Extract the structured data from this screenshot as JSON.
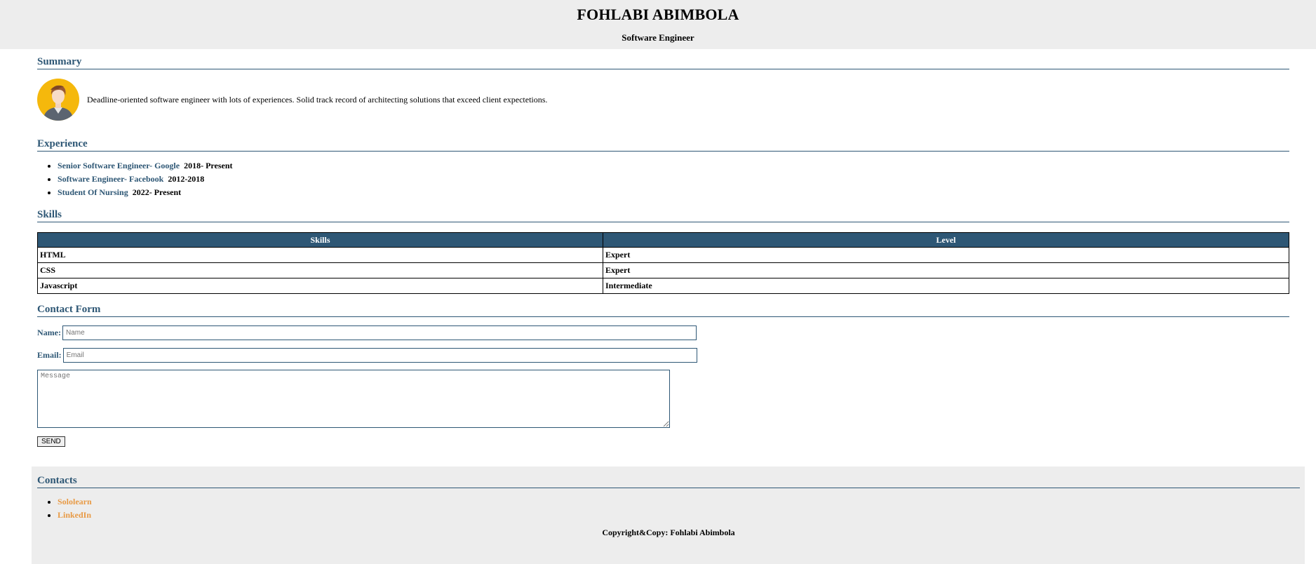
{
  "header": {
    "name": "FOHLABI ABIMBOLA",
    "role": "Software Engineer"
  },
  "summary": {
    "title": "Summary",
    "avatar_icon": "person-avatar-icon",
    "text": "Deadline-oriented software engineer with lots of experiences. Solid track record of architecting solutions that exceed client expectetions."
  },
  "experience": {
    "title": "Experience",
    "items": [
      {
        "role": "Senior Software Engineer- Google",
        "years": "2018- Present"
      },
      {
        "role": "Software Engineer- Facebook",
        "years": "2012-2018"
      },
      {
        "role": "Student Of Nursing",
        "years": "2022- Present"
      }
    ]
  },
  "skills": {
    "title": "Skills",
    "headers": [
      "Skills",
      "Level"
    ],
    "rows": [
      [
        "HTML",
        "Expert"
      ],
      [
        "CSS",
        "Expert"
      ],
      [
        "Javascript",
        "Intermediate"
      ]
    ]
  },
  "contact_form": {
    "title": "Contact Form",
    "name_label": "Name:",
    "name_placeholder": "Name",
    "email_label": "Email:",
    "email_placeholder": "Email",
    "message_placeholder": "Message",
    "send_label": "SEND"
  },
  "footer": {
    "title": "Contacts",
    "links": [
      "Sololearn",
      "LinkedIn"
    ],
    "copyright": "Copyright&Copy: Fohlabi Abimbola"
  },
  "colors": {
    "accent": "#2e5775",
    "link": "#e89a45",
    "header_bg": "#ededed"
  }
}
